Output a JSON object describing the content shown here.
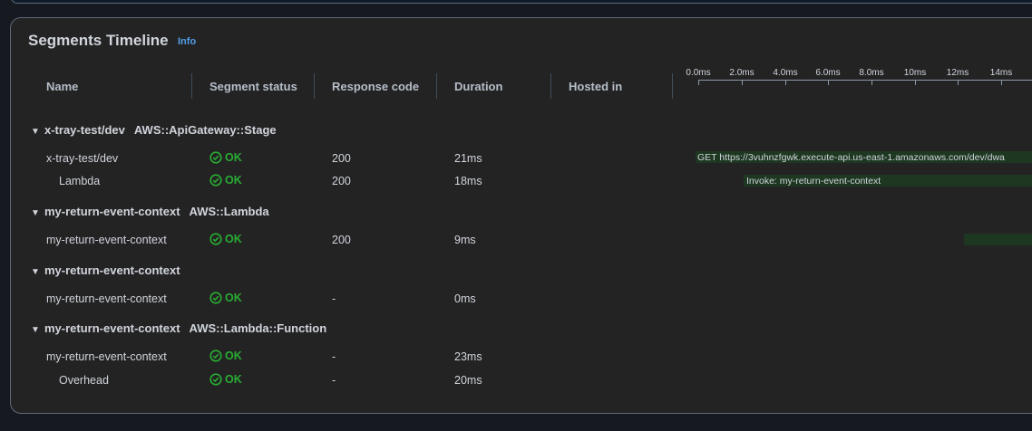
{
  "panel": {
    "title": "Segments Timeline",
    "info_label": "Info"
  },
  "columns": {
    "name": "Name",
    "segment_status": "Segment status",
    "response_code": "Response code",
    "duration": "Duration",
    "hosted_in": "Hosted in"
  },
  "timeline": {
    "ticks": [
      "0.0ms",
      "2.0ms",
      "4.0ms",
      "6.0ms",
      "8.0ms",
      "10ms",
      "12ms",
      "14ms"
    ]
  },
  "groups": [
    {
      "name": "x-tray-test/dev",
      "type": "AWS::ApiGateway::Stage"
    },
    {
      "name": "my-return-event-context",
      "type": "AWS::Lambda"
    },
    {
      "name": "my-return-event-context",
      "type": ""
    },
    {
      "name": "my-return-event-context",
      "type": "AWS::Lambda::Function"
    }
  ],
  "rows": [
    {
      "name": "x-tray-test/dev",
      "status": "OK",
      "response_code": "200",
      "duration": "21ms",
      "bar_label": "GET https://3vuhnzfgwk.execute-api.us-east-1.amazonaws.com/dev/dwa"
    },
    {
      "name": "Lambda",
      "status": "OK",
      "response_code": "200",
      "duration": "18ms",
      "bar_label": "Invoke: my-return-event-context"
    },
    {
      "name": "my-return-event-context",
      "status": "OK",
      "response_code": "200",
      "duration": "9ms",
      "bar_label": ""
    },
    {
      "name": "my-return-event-context",
      "status": "OK",
      "response_code": "-",
      "duration": "0ms",
      "bar_label": ""
    },
    {
      "name": "my-return-event-context",
      "status": "OK",
      "response_code": "-",
      "duration": "23ms",
      "bar_label": ""
    },
    {
      "name": "Overhead",
      "status": "OK",
      "response_code": "-",
      "duration": "20ms",
      "bar_label": ""
    }
  ],
  "colors": {
    "ok": "#29ad32",
    "bar": "#1d3721",
    "link": "#539fe5"
  }
}
